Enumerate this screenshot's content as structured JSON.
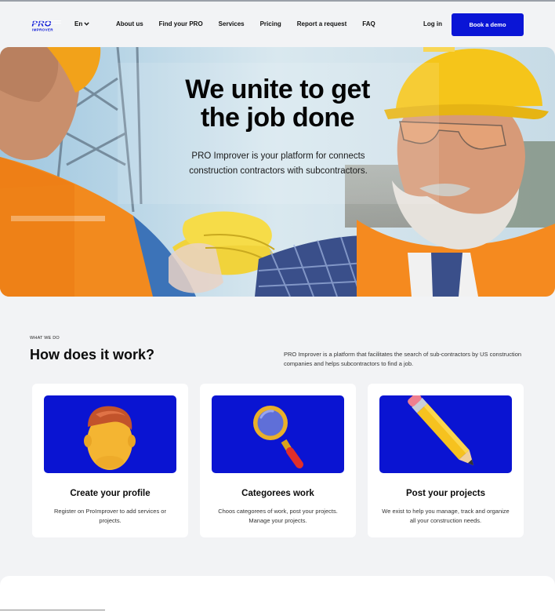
{
  "header": {
    "logo_text_top": "PRO",
    "logo_text_bottom": "IMPROVER",
    "language": "En",
    "nav": [
      "About us",
      "Find your PRO",
      "Services",
      "Pricing",
      "Report a request",
      "FAQ"
    ],
    "login": "Log in",
    "cta": "Book a demo"
  },
  "hero": {
    "title_line1": "We unite to get",
    "title_line2": "the job done",
    "subtitle": "PRO Improver is your platform for connects construction contractors with subcontractors."
  },
  "how": {
    "eyebrow": "WHAT WE DO",
    "title": "How does it work?",
    "description": "PRO Improver is a platform that facilitates the search of sub-contractors by US construction companies and helps subcontractors to find a job."
  },
  "cards": [
    {
      "icon": "profile-avatar-icon",
      "title": "Create your profile",
      "text": "Register on ProImprover to add services or projects."
    },
    {
      "icon": "magnifier-icon",
      "title": "Categorees work",
      "text": "Choos categorees of work, post your projects.  Manage your projects."
    },
    {
      "icon": "pencil-icon",
      "title": "Post your projects",
      "text": "We exist to help you manage, track and organize all your construction needs."
    }
  ],
  "colors": {
    "brand_blue": "#0a15d6",
    "background": "#f2f3f5",
    "hard_hat_yellow": "#f5c51a",
    "vest_orange": "#f58a1f"
  }
}
